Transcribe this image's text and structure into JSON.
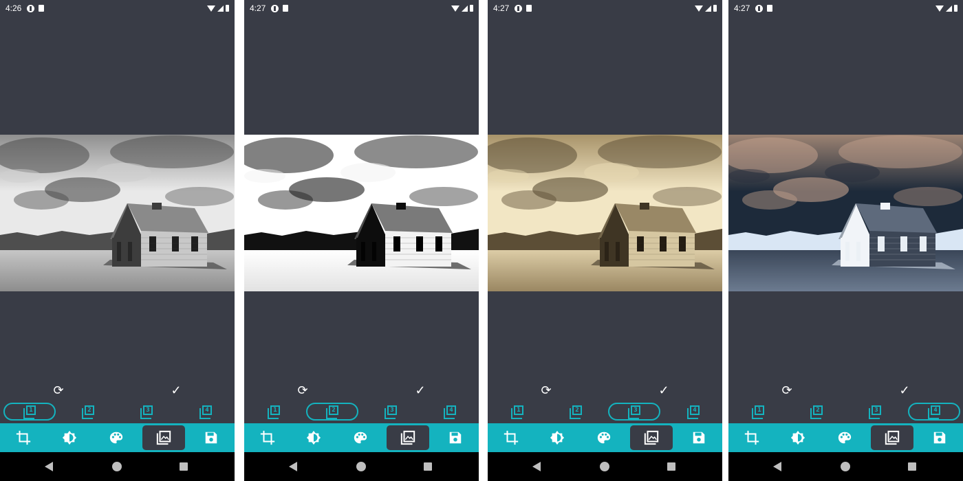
{
  "theme": {
    "panel_bg": "#393c46",
    "accent": "#14b3bf",
    "nav_bg": "#000000",
    "icon_color": "#ffffff"
  },
  "screens": [
    {
      "status_time": "4:26",
      "effect": "grayscale",
      "selected_filter_index": 0,
      "selected_tool": "filters"
    },
    {
      "status_time": "4:27",
      "effect": "black-and-white",
      "selected_filter_index": 1,
      "selected_tool": "filters"
    },
    {
      "status_time": "4:27",
      "effect": "sepia",
      "selected_filter_index": 2,
      "selected_tool": "filters"
    },
    {
      "status_time": "4:27",
      "effect": "negative",
      "selected_filter_index": 3,
      "selected_tool": "filters"
    }
  ],
  "filters": [
    "1",
    "2",
    "3",
    "4"
  ],
  "actions": {
    "reset_icon": "sync-icon",
    "apply_icon": "check-icon"
  },
  "toolbar": [
    {
      "id": "crop",
      "icon": "crop-icon"
    },
    {
      "id": "adjust",
      "icon": "brightness-icon"
    },
    {
      "id": "color",
      "icon": "palette-icon"
    },
    {
      "id": "filters",
      "icon": "image-filter-icon"
    },
    {
      "id": "save",
      "icon": "save-icon"
    }
  ],
  "navigation": [
    "back-icon",
    "home-icon",
    "recents-icon"
  ]
}
